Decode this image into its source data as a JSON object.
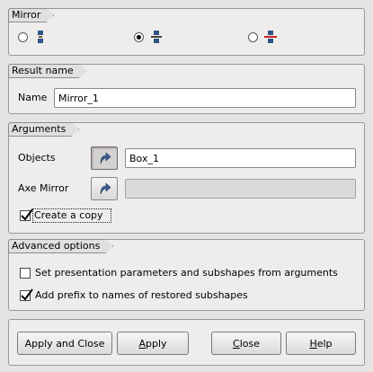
{
  "mirror_group": {
    "title": "Mirror",
    "options": [
      {
        "icon": "mirror-point-icon",
        "selected": false
      },
      {
        "icon": "mirror-axis-icon",
        "selected": true
      },
      {
        "icon": "mirror-plane-icon",
        "selected": false
      }
    ]
  },
  "result_group": {
    "title": "Result name",
    "name_label": "Name",
    "name_value": "Mirror_1"
  },
  "arguments_group": {
    "title": "Arguments",
    "objects_label": "Objects",
    "objects_value": "Box_1",
    "axe_label": "Axe Mirror",
    "axe_value": "",
    "create_copy_label": "Create a copy",
    "create_copy_checked": true
  },
  "advanced_group": {
    "title": "Advanced options",
    "presentation_label": "Set presentation parameters and subshapes from arguments",
    "presentation_checked": false,
    "prefix_label": "Add prefix to names of restored subshapes",
    "prefix_checked": true
  },
  "buttons": {
    "apply_close": "Apply and Close",
    "apply_first": "A",
    "apply_rest": "pply",
    "close_first": "C",
    "close_rest": "lose",
    "help_first": "H",
    "help_rest": "elp"
  },
  "colors": {
    "background": "#e6e4e2",
    "panel": "#efedeb",
    "arrow_icon": "#3b5f8e",
    "mirror_icon_red": "#c8231e"
  }
}
